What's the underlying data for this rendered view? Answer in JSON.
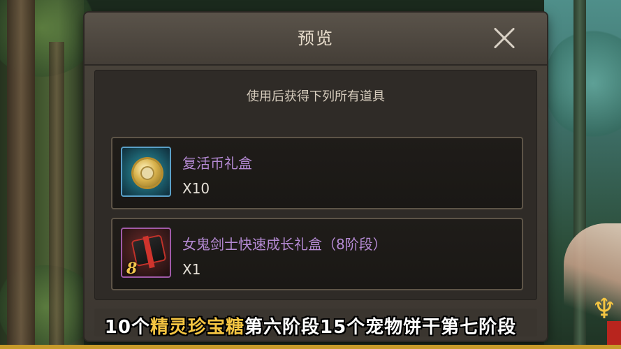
{
  "dialog": {
    "title": "预览",
    "subtitle": "使用后获得下列所有道具",
    "items": [
      {
        "name": "复活币礼盒",
        "quantity": "X10",
        "icon": "coin-icon"
      },
      {
        "name": "女鬼剑士快速成长礼盒（8阶段）",
        "quantity": "X1",
        "icon": "gift-box-icon",
        "badge": "8"
      }
    ]
  },
  "caption": {
    "part1": "10个",
    "highlight": "精灵珍宝糖",
    "part2": "第六阶段15个宠物饼干第七阶段"
  },
  "colors": {
    "item_name": "#b58ad4",
    "highlight": "#f5c542"
  }
}
